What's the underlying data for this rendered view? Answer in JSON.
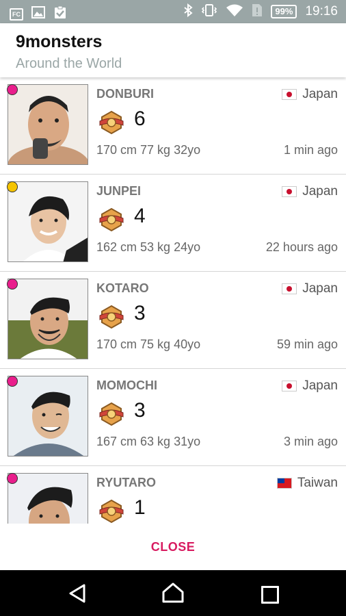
{
  "status_bar": {
    "left_icons": [
      "fc-icon",
      "image-icon",
      "clipboard-check-icon"
    ],
    "left_icon_text": "FC",
    "battery": "99%",
    "time": "19:16"
  },
  "header": {
    "title": "9monsters",
    "subtitle": "Around the World"
  },
  "users": [
    {
      "name": "DONBURI",
      "country": "Japan",
      "flag": "jp",
      "count": "6",
      "stats": "170 cm 77 kg 32yo",
      "ago": "1 min ago",
      "dot_color": "#e91e8c"
    },
    {
      "name": "JUNPEI",
      "country": "Japan",
      "flag": "jp",
      "count": "4",
      "stats": "162 cm 53 kg 24yo",
      "ago": "22 hours ago",
      "dot_color": "#f5c400"
    },
    {
      "name": "KOTARO",
      "country": "Japan",
      "flag": "jp",
      "count": "3",
      "stats": "170 cm 75 kg 40yo",
      "ago": "59 min ago",
      "dot_color": "#e91e8c"
    },
    {
      "name": "MOMOCHI",
      "country": "Japan",
      "flag": "jp",
      "count": "3",
      "stats": "167 cm 63 kg 31yo",
      "ago": "3 min ago",
      "dot_color": "#e91e8c"
    },
    {
      "name": "RYUTARO",
      "country": "Taiwan",
      "flag": "tw",
      "count": "1",
      "stats": "",
      "ago": "",
      "dot_color": "#e91e8c"
    }
  ],
  "dialog": {
    "close_label": "CLOSE"
  },
  "colors": {
    "accent": "#d81b60",
    "status_bar": "#9aa6a6",
    "subtitle": "#9aa6a6"
  }
}
